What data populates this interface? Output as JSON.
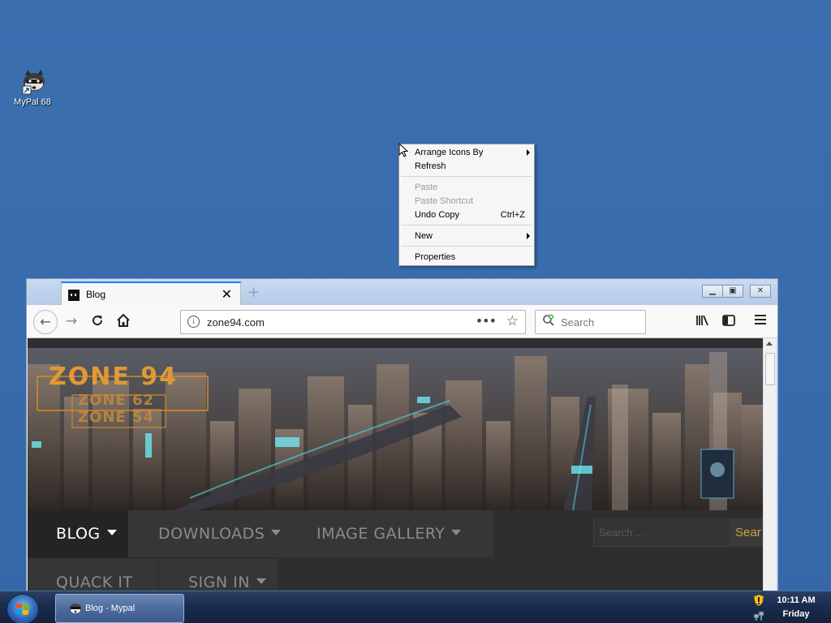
{
  "desktop": {
    "icons": [
      {
        "label": "MyPal 68",
        "icon": "raccoon-icon"
      }
    ]
  },
  "context_menu": {
    "items": [
      {
        "label": "Arrange Icons By",
        "submenu": true,
        "enabled": true
      },
      {
        "label": "Refresh",
        "enabled": true
      },
      {
        "label": "Paste",
        "enabled": false
      },
      {
        "label": "Paste Shortcut",
        "enabled": false
      },
      {
        "label": "Undo Copy",
        "shortcut": "Ctrl+Z",
        "enabled": true
      },
      {
        "label": "New",
        "submenu": true,
        "enabled": true
      },
      {
        "label": "Properties",
        "enabled": true
      }
    ]
  },
  "browser": {
    "tab_title": "Blog",
    "new_tab_symbol": "+",
    "url": "zone94.com",
    "search_placeholder": "Search",
    "accent_color": "#0a84ff"
  },
  "site": {
    "logo_lines": [
      "ZONE 94",
      "ZONE 62",
      "ZONE 54"
    ],
    "nav_items": [
      {
        "label": "BLOG",
        "active": true,
        "dropdown": true
      },
      {
        "label": "DOWNLOADS",
        "active": false,
        "dropdown": true
      },
      {
        "label": "IMAGE GALLERY",
        "active": false,
        "dropdown": true
      },
      {
        "label": "QUACK IT",
        "active": false,
        "dropdown": false
      },
      {
        "label": "SIGN IN",
        "active": false,
        "dropdown": true
      }
    ],
    "search_placeholder": "Search ...",
    "search_button": "Sear",
    "accent_color": "#d0a44a"
  },
  "taskbar": {
    "task_label": "Blog - Mypal",
    "time": "10:11 AM",
    "day": "Friday"
  }
}
